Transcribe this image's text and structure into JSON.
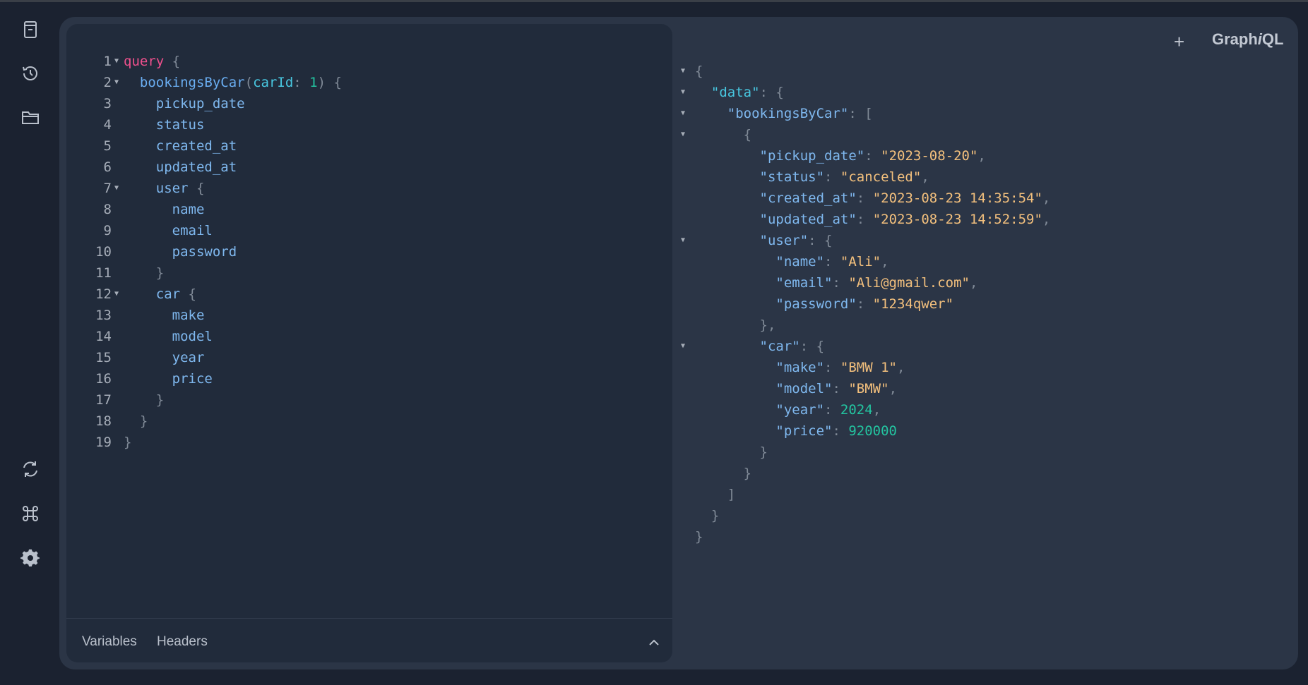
{
  "sidebar": {
    "icons": [
      "docs-icon",
      "history-icon",
      "explorer-icon",
      "refetch-schema-icon",
      "shortcuts-icon",
      "settings-icon"
    ]
  },
  "header": {
    "plus_label": "+",
    "brand_part1": "Graph",
    "brand_part2": "i",
    "brand_part3": "QL"
  },
  "editor": {
    "line_numbers": [
      "1",
      "2",
      "3",
      "4",
      "5",
      "6",
      "7",
      "8",
      "9",
      "10",
      "11",
      "12",
      "13",
      "14",
      "15",
      "16",
      "17",
      "18",
      "19"
    ],
    "tokens": {
      "l1_kw": "query",
      "l1_brace": " {",
      "l2_field": "bookingsByCar",
      "l2_open": "(",
      "l2_arg": "carId",
      "l2_colon": ": ",
      "l2_val": "1",
      "l2_close": ") {",
      "l3": "pickup_date",
      "l4": "status",
      "l5": "created_at",
      "l6": "updated_at",
      "l7_field": "user",
      "l7_brace": " {",
      "l8": "name",
      "l9": "email",
      "l10": "password",
      "l11": "}",
      "l12_field": "car",
      "l12_brace": " {",
      "l13": "make",
      "l14": "model",
      "l15": "year",
      "l16": "price",
      "l17": "}",
      "l18": "}",
      "l19": "}"
    },
    "footer": {
      "variables_label": "Variables",
      "headers_label": "Headers"
    }
  },
  "result": {
    "k_data": "\"data\"",
    "k_bookings": "\"bookingsByCar\"",
    "k_pickup": "\"pickup_date\"",
    "v_pickup": "\"2023-08-20\"",
    "k_status": "\"status\"",
    "v_status": "\"canceled\"",
    "k_created": "\"created_at\"",
    "v_created": "\"2023-08-23 14:35:54\"",
    "k_updated": "\"updated_at\"",
    "v_updated": "\"2023-08-23 14:52:59\"",
    "k_user": "\"user\"",
    "k_name": "\"name\"",
    "v_name": "\"Ali\"",
    "k_email": "\"email\"",
    "v_email": "\"Ali@gmail.com\"",
    "k_password": "\"password\"",
    "v_password": "\"1234qwer\"",
    "k_car": "\"car\"",
    "k_make": "\"make\"",
    "v_make": "\"BMW 1\"",
    "k_model": "\"model\"",
    "v_model": "\"BMW\"",
    "k_year": "\"year\"",
    "v_year": "2024",
    "k_price": "\"price\"",
    "v_price": "920000"
  }
}
